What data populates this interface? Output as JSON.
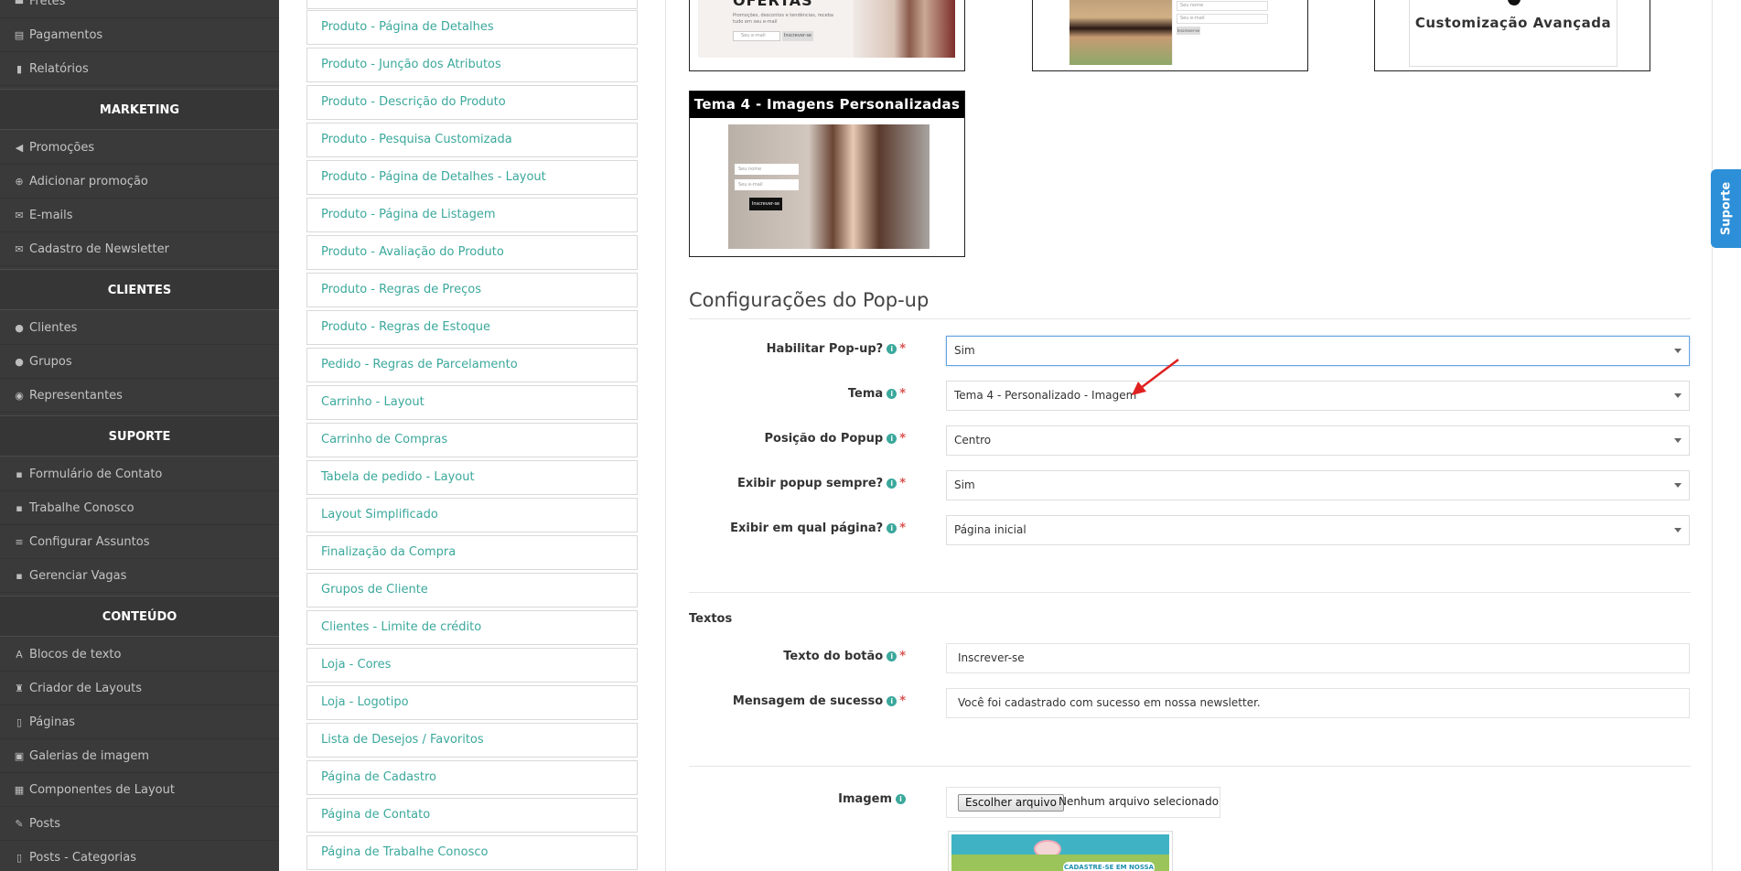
{
  "sidebar": {
    "items_top": [
      {
        "icon": "truck-icon",
        "glyph": "▬",
        "label": "Fretes"
      },
      {
        "icon": "money-icon",
        "glyph": "▤",
        "label": "Pagamentos"
      },
      {
        "icon": "bar-chart-icon",
        "glyph": "▮",
        "label": "Relatórios"
      }
    ],
    "sections": [
      {
        "title": "MARKETING",
        "items": [
          {
            "icon": "megaphone-icon",
            "glyph": "◀",
            "label": "Promoções"
          },
          {
            "icon": "plus-circle-icon",
            "glyph": "⊕",
            "label": "Adicionar promoção"
          },
          {
            "icon": "envelope-icon",
            "glyph": "✉",
            "label": "E-mails"
          },
          {
            "icon": "envelope-icon",
            "glyph": "✉",
            "label": "Cadastro de Newsletter"
          }
        ]
      },
      {
        "title": "CLIENTES",
        "items": [
          {
            "icon": "user-icon",
            "glyph": "●",
            "label": "Clientes"
          },
          {
            "icon": "users-icon",
            "glyph": "●",
            "label": "Grupos"
          },
          {
            "icon": "user-circle-icon",
            "glyph": "◉",
            "label": "Representantes"
          }
        ]
      },
      {
        "title": "SUPORTE",
        "items": [
          {
            "icon": "comment-icon",
            "glyph": "▪",
            "label": "Formulário de Contato"
          },
          {
            "icon": "briefcase-icon",
            "glyph": "▪",
            "label": "Trabalhe Conosco"
          },
          {
            "icon": "list-icon",
            "glyph": "≡",
            "label": "Configurar Assuntos"
          },
          {
            "icon": "briefcase-icon",
            "glyph": "▪",
            "label": "Gerenciar Vagas"
          }
        ]
      },
      {
        "title": "CONTEÚDO",
        "items": [
          {
            "icon": "font-icon",
            "glyph": "A",
            "label": "Blocos de texto"
          },
          {
            "icon": "chess-icon",
            "glyph": "♜",
            "label": "Criador de Layouts"
          },
          {
            "icon": "file-icon",
            "glyph": "▯",
            "label": "Páginas"
          },
          {
            "icon": "image-icon",
            "glyph": "▣",
            "label": "Galerias de imagem"
          },
          {
            "icon": "th-large-icon",
            "glyph": "▦",
            "label": "Componentes de Layout"
          },
          {
            "icon": "thumbtack-icon",
            "glyph": "✎",
            "label": "Posts"
          },
          {
            "icon": "file-icon",
            "glyph": "▯",
            "label": "Posts - Categorias"
          }
        ]
      }
    ]
  },
  "settings_list": [
    "Produto - Página de Detalhes",
    "Produto - Junção dos Atributos",
    "Produto - Descrição do Produto",
    "Produto - Pesquisa Customizada",
    "Produto - Página de Detalhes - Layout",
    "Produto - Página de Listagem",
    "Produto - Avaliação do Produto",
    "Produto - Regras de Preços",
    "Produto - Regras de Estoque",
    "Pedido - Regras de Parcelamento",
    "Carrinho - Layout",
    "Carrinho de Compras",
    "Tabela de pedido - Layout",
    "Layout Simplificado",
    "Finalização da Compra",
    "Grupos de Cliente",
    "Clientes - Limite de crédito",
    "Loja - Cores",
    "Loja - Logotipo",
    "Lista de Desejos / Favoritos",
    "Página de Cadastro",
    "Página de Contato",
    "Página de Trabalhe Conosco"
  ],
  "themes": {
    "card1": {
      "headline": "OFERTAS",
      "text": "Promoções, descontos e tendências, receba tudo em seu e-mail",
      "email_placeholder": "Seu e-mail",
      "button": "Inscrever-se"
    },
    "card2": {
      "field1": "Seu nome",
      "field2": "Seu e-mail",
      "button": "Inscrever-se"
    },
    "card3": {
      "label": "Customização Avançada"
    },
    "card4": {
      "title": "Tema 4 - Imagens Personalizadas",
      "field1": "Seu nome",
      "field2": "Seu e-mail",
      "button": "Inscrever-se"
    }
  },
  "popup_config": {
    "title": "Configurações do Pop-up",
    "fields": [
      {
        "label": "Habilitar Pop-up?",
        "value": "Sim"
      },
      {
        "label": "Tema",
        "value": "Tema 4 - Personalizado - Imagem"
      },
      {
        "label": "Posição do Popup",
        "value": "Centro"
      },
      {
        "label": "Exibir popup sempre?",
        "value": "Sim"
      },
      {
        "label": "Exibir em qual página?",
        "value": "Página inicial"
      }
    ],
    "texts_heading": "Textos",
    "text_fields": [
      {
        "label": "Texto do botão",
        "value": "Inscrever-se"
      },
      {
        "label": "Mensagem de sucesso",
        "value": "Você foi cadastrado com sucesso em nossa newsletter."
      }
    ],
    "image_label": "Imagem",
    "file_button": "Escolher arquivo",
    "file_status": "Nenhum arquivo selecionado",
    "preview_text": "CADASTRE-SE EM NOSSA"
  },
  "support_tab": "Suporte",
  "colors": {
    "accent": "#3ba89c",
    "sidebar": "#3a3a3a",
    "required": "#d9534f",
    "support": "#2d8fd8",
    "arrow": "#e02020"
  }
}
